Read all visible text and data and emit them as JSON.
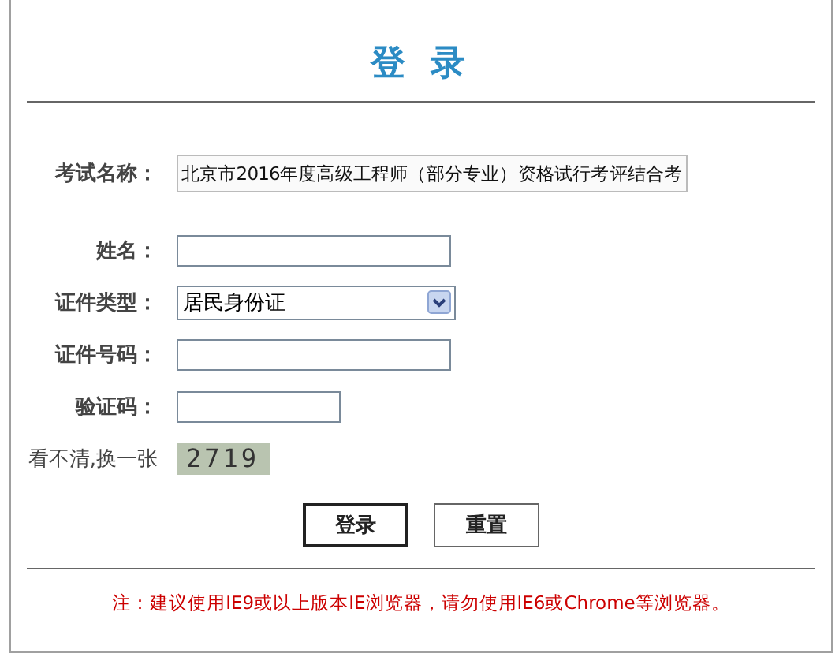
{
  "title": "登 录",
  "fields": [
    {
      "kind": "readonly",
      "label": "考试名称：",
      "value": "北京市2016年度高级工程师（部分专业）资格试行考评结合考"
    },
    {
      "kind": "text",
      "label": "姓名："
    },
    {
      "kind": "select",
      "label": "证件类型：",
      "value": "居民身份证"
    },
    {
      "kind": "text",
      "label": "证件号码："
    },
    {
      "kind": "short",
      "label": "验证码："
    },
    {
      "kind": "captcha",
      "label": "看不清,换一张",
      "value": "2719"
    }
  ],
  "buttons": [
    {
      "label": "登录",
      "selected": true
    },
    {
      "label": "重置",
      "selected": false
    }
  ],
  "note": "注：建议使用IE9或以上版本IE浏览器，请勿使用IE6或Chrome等浏览器。"
}
